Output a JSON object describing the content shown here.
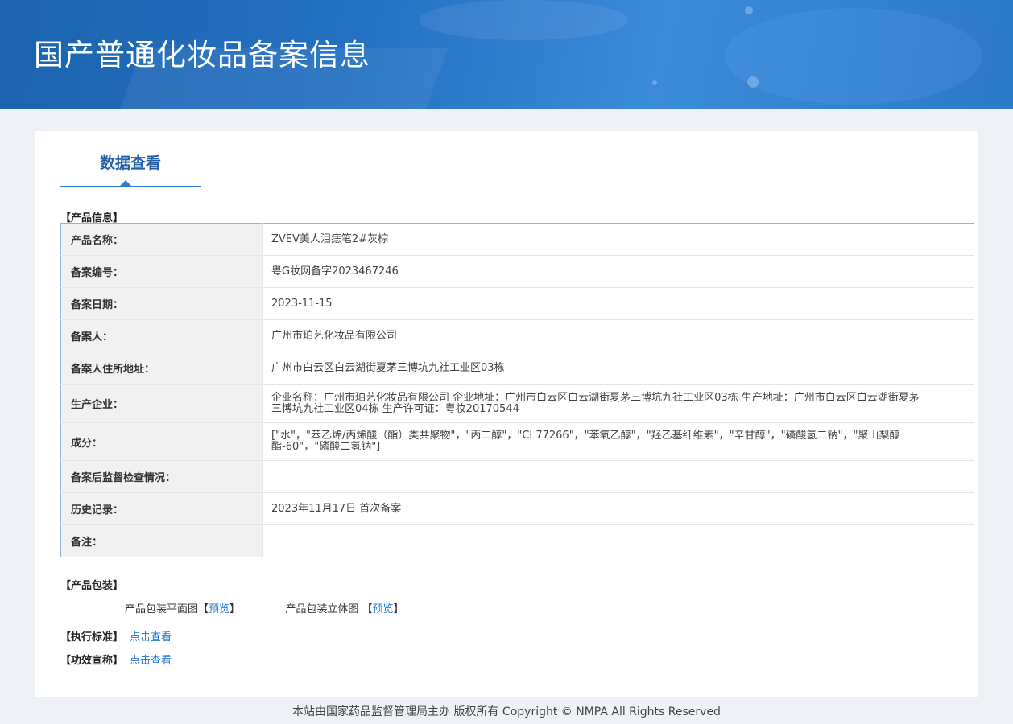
{
  "header": {
    "title": "国产普通化妆品备案信息"
  },
  "tabs": [
    {
      "label": "数据查看"
    }
  ],
  "product_info": {
    "section_title": "【产品信息】",
    "rows": [
      {
        "key": "产品名称：",
        "value": "ZVEV美人泪痣笔2#灰棕"
      },
      {
        "key": "备案编号：",
        "value": "粤G妆网备字2023467246"
      },
      {
        "key": "备案日期：",
        "value": "2023-11-15"
      },
      {
        "key": "备案人：",
        "value": "广州市珀艺化妆品有限公司"
      },
      {
        "key": "备案人住所地址：",
        "value": "广州市白云区白云湖街夏茅三博坑九社工业区03栋"
      },
      {
        "key": "生产企业：",
        "value": "企业名称：广州市珀艺化妆品有限公司 企业地址：广州市白云区白云湖街夏茅三博坑九社工业区03栋 生产地址：广州市白云区白云湖街夏茅三博坑九社工业区04栋 生产许可证：粤妆20170544"
      },
      {
        "key": "成分：",
        "value": "[\"水\"，\"苯乙烯/丙烯酸（酯）类共聚物\"，\"丙二醇\"，\"CI 77266\"，\"苯氧乙醇\"，\"羟乙基纤维素\"，\"辛甘醇\"，\"磷酸氢二钠\"，\"聚山梨醇酯-60\"，\"磷酸二氢钠\"]"
      },
      {
        "key": "备案后监督检查情况：",
        "value": ""
      },
      {
        "key": "历史记录：",
        "value": "2023年11月17日 首次备案"
      },
      {
        "key": "备注：",
        "value": ""
      }
    ]
  },
  "packaging": {
    "section_title": "【产品包装】",
    "flat_label": "产品包装平面图【",
    "flat_link": "预览",
    "flat_close": "】",
    "solid_label": "产品包装立体图 【",
    "solid_link": "预览",
    "solid_close": "】"
  },
  "standard": {
    "label": "【执行标准】",
    "link": "点击查看"
  },
  "efficacy": {
    "label": "【功效宣称】",
    "link": "点击查看"
  },
  "footer": {
    "text": "本站由国家药品监督管理局主办 版权所有 Copyright © NMPA All Rights Reserved"
  }
}
